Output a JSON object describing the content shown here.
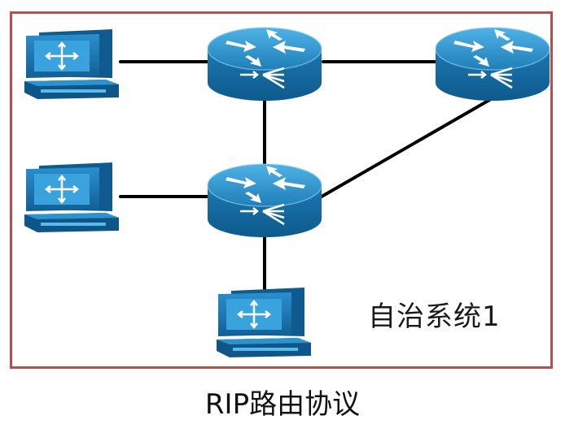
{
  "diagram": {
    "region_label": "自治系统1",
    "caption": "RIP路由协议"
  },
  "nodes": [
    {
      "id": "pc-1",
      "kind": "workstation"
    },
    {
      "id": "pc-2",
      "kind": "workstation"
    },
    {
      "id": "pc-3",
      "kind": "workstation"
    },
    {
      "id": "router-1",
      "kind": "router"
    },
    {
      "id": "router-2",
      "kind": "router"
    },
    {
      "id": "router-3",
      "kind": "router"
    }
  ],
  "links": [
    [
      "pc-1",
      "router-1"
    ],
    [
      "router-1",
      "router-2"
    ],
    [
      "router-2",
      "router-3"
    ],
    [
      "pc-2",
      "router-3"
    ],
    [
      "router-1",
      "router-3"
    ],
    [
      "pc-3",
      "router-3"
    ]
  ],
  "colors": {
    "border": "#b5504f",
    "router": "#1f7fb8",
    "workstation": "#1a75b0",
    "link": "#000000"
  },
  "icons": {
    "router": "router-icon",
    "workstation": "workstation-icon"
  }
}
